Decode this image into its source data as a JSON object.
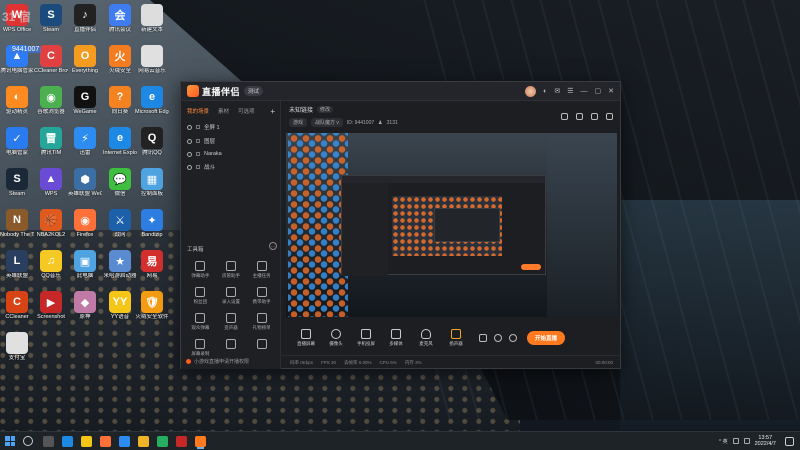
{
  "desktop": {
    "overlay_text": "31 宿",
    "overlay_id": "9441007",
    "icons": [
      {
        "label": "WPS Office",
        "color": "#d33",
        "glyph": "W"
      },
      {
        "label": "Steam",
        "color": "#1b4b7c",
        "glyph": "S"
      },
      {
        "label": "直播伴侣",
        "color": "#222",
        "glyph": "♪"
      },
      {
        "label": "腾讯会议",
        "color": "#3f7cf0",
        "glyph": "会"
      },
      {
        "label": "新建文本",
        "color": "#ddd",
        "glyph": ""
      },
      {
        "label": "腾讯电脑管家",
        "color": "#2d7bf5",
        "glyph": "▲"
      },
      {
        "label": "CCleaner Browser",
        "color": "#e04040",
        "glyph": "C"
      },
      {
        "label": "Everything",
        "color": "#f59b1f",
        "glyph": "O"
      },
      {
        "label": "火绒安全",
        "color": "#f37c20",
        "glyph": "火"
      },
      {
        "label": "网易云音乐",
        "color": "#e0e0e0",
        "glyph": ""
      },
      {
        "label": "驱动精灵",
        "color": "#ff8a1f",
        "glyph": "◐"
      },
      {
        "label": "谷歌浏览器",
        "color": "#4caf50",
        "glyph": "◉"
      },
      {
        "label": "WeGame",
        "color": "#111",
        "glyph": "G"
      },
      {
        "label": "向日葵",
        "color": "#f58220",
        "glyph": "?"
      },
      {
        "label": "Microsoft Edge",
        "color": "#1e88e5",
        "glyph": "e"
      },
      {
        "label": "电脑管家",
        "color": "#2b7bf0",
        "glyph": "✓"
      },
      {
        "label": "腾讯TIM",
        "color": "#26a69a",
        "glyph": "冒"
      },
      {
        "label": "迅雷",
        "color": "#2d8cf0",
        "glyph": "⚡"
      },
      {
        "label": "Internet Explorer",
        "color": "#1e88e5",
        "glyph": "e"
      },
      {
        "label": "腾讯QQ",
        "color": "#222",
        "glyph": "Q"
      },
      {
        "label": "Steam",
        "color": "#1b2838",
        "glyph": "S"
      },
      {
        "label": "WPS",
        "color": "#6a4bd6",
        "glyph": "▲"
      },
      {
        "label": "英雄联盟 WeGame",
        "color": "#3a6ea5",
        "glyph": "⬢"
      },
      {
        "label": "微信",
        "color": "#3fbf3f",
        "glyph": "💬"
      },
      {
        "label": "控制面板",
        "color": "#4fa3e0",
        "glyph": "▦"
      },
      {
        "label": "Nobody The Turnaround",
        "color": "#8b5a2b",
        "glyph": "N"
      },
      {
        "label": "NBA2KOL2",
        "color": "#e05a1f",
        "glyph": "🏀"
      },
      {
        "label": "Firefox",
        "color": "#ff7139",
        "glyph": "◉"
      },
      {
        "label": "战网",
        "color": "#1d5fa8",
        "glyph": "⚔"
      },
      {
        "label": "Bandizip",
        "color": "#2e7de0",
        "glyph": "✦"
      },
      {
        "label": "英雄联盟",
        "color": "#2a3f5f",
        "glyph": "L"
      },
      {
        "label": "QQ音乐",
        "color": "#f6c823",
        "glyph": "♫"
      },
      {
        "label": "此电脑",
        "color": "#4fa3e0",
        "glyph": "▣"
      },
      {
        "label": "米哈游启动器",
        "color": "#5a8ad0",
        "glyph": "★"
      },
      {
        "label": "网易",
        "color": "#d32f2f",
        "glyph": "易"
      },
      {
        "label": "CCleaner",
        "color": "#d84315",
        "glyph": "C"
      },
      {
        "label": "Screenshot",
        "color": "#c62828",
        "glyph": "▶"
      },
      {
        "label": "原神",
        "color": "#c07aa8",
        "glyph": "◆"
      },
      {
        "label": "YY语音",
        "color": "#f5c518",
        "glyph": "YY"
      },
      {
        "label": "火绒安全软件",
        "color": "#f39c12",
        "glyph": "🛡"
      },
      {
        "label": "支付宝",
        "color": "#e0e0e0",
        "glyph": ""
      }
    ]
  },
  "app": {
    "name": "直播伴侣",
    "version_badge": "测试",
    "left_tabs": [
      "我的场景",
      "素材",
      "可选项"
    ],
    "add_label": "+",
    "scenes": [
      "全屏 1",
      "图层",
      "Naraka",
      "战斗"
    ],
    "tools_title": "工具箱",
    "tools_more": "…",
    "tools": [
      "弹幕助手",
      "房管助手",
      "主播任务",
      "粉丝团",
      "录入设置",
      "携带助手",
      "观众弹幕",
      "变声器",
      "礼物榜单",
      "屏幕录制",
      "",
      ""
    ],
    "bottom_notice": "小游戏直播申请开播权限",
    "main_title": "未知链接",
    "edit_tag": "修改",
    "meta": {
      "category": "游戏",
      "subcategory": "战队魔方 v",
      "room_id": "ID: 9441007",
      "fans": "3131"
    },
    "bottom_tools": [
      "直播屏幕",
      "摄像头",
      "手机投屏",
      "多媒体",
      "麦克风",
      "扬声器"
    ],
    "go_live": "开始直播",
    "status": {
      "bitrate": "码率 0Kbps",
      "fps": "FPS 30",
      "loss": "丢帧率 0.00%",
      "cpu": "CPU 6%",
      "mem": "内存 3%",
      "time": "00:00:00"
    }
  },
  "taskbar": {
    "apps": [
      {
        "name": "task-view",
        "color": "#555"
      },
      {
        "name": "edge",
        "color": "#1e88e5"
      },
      {
        "name": "file-explorer",
        "color": "#f5c518"
      },
      {
        "name": "firefox",
        "color": "#ff7139"
      },
      {
        "name": "qq",
        "color": "#2d8cf0"
      },
      {
        "name": "wegame",
        "color": "#f0b429"
      },
      {
        "name": "qq-music",
        "color": "#27ae60"
      },
      {
        "name": "screenshot",
        "color": "#c62828"
      },
      {
        "name": "live-companion",
        "color": "#ff7a1f"
      }
    ],
    "tray_text": "^ 英",
    "time": "13:57",
    "date": "2022/4/7"
  }
}
